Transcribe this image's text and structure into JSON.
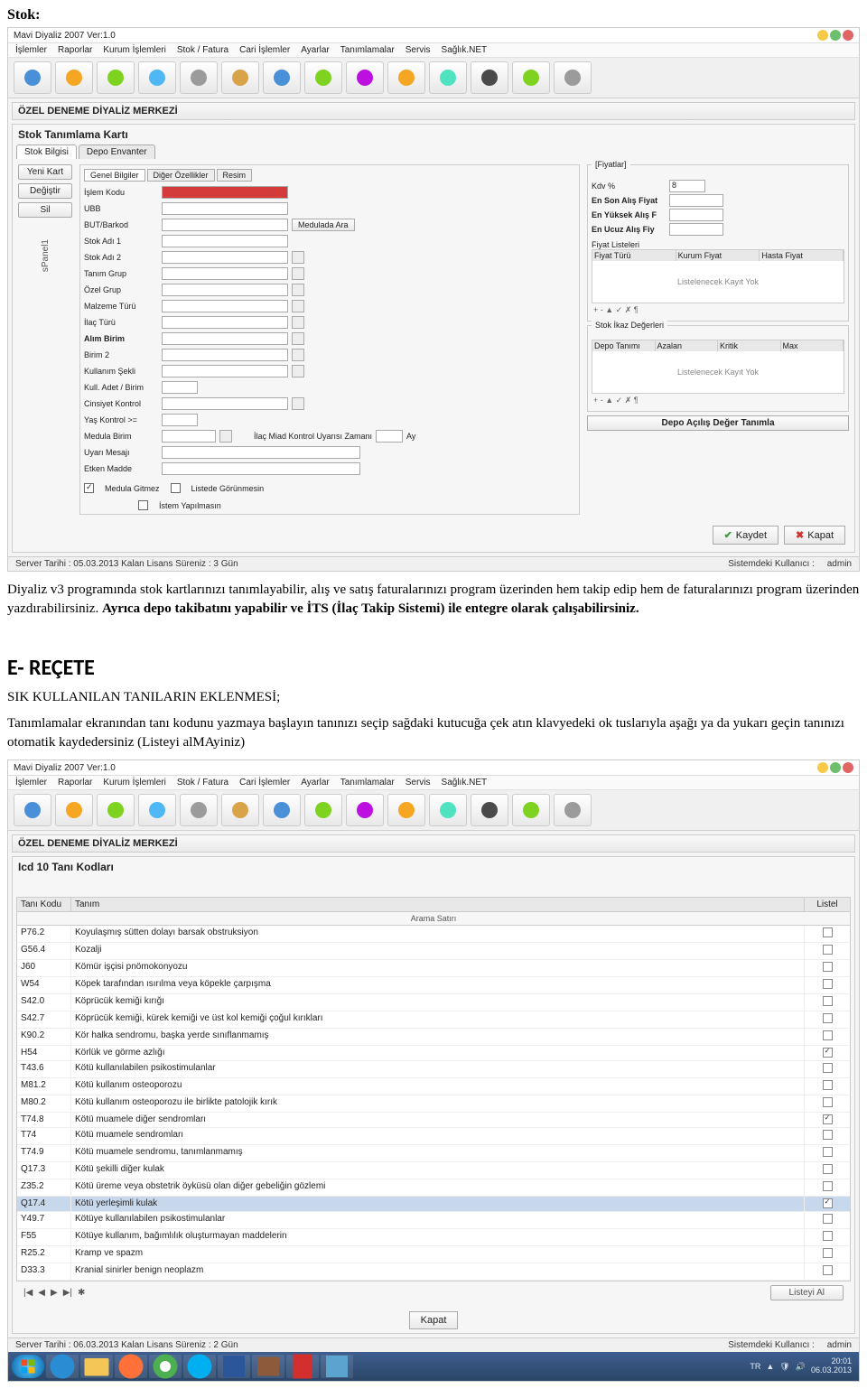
{
  "doc": {
    "heading_stok": "Stok:",
    "para1_plain": "Diyaliz v3 programında stok kartlarınızı tanımlayabilir, alış ve satış faturalarınızı program üzerinden hem takip edip hem de faturalarınızı program üzerinden yazdırabilirsiniz. ",
    "para1_bold": "Ayrıca depo takibatını yapabilir ve İTS (İlaç Takip Sistemi) ile entegre olarak çalışabilirsiniz.",
    "heading_erecete": "E- REÇETE",
    "para2": "SIK KULLANILAN TANILARIN EKLENMESİ;",
    "para3": "Tanımlamalar ekranından tanı kodunu yazmaya başlayın tanınızı seçip sağdaki kutucuğa çek atın klavyedeki ok tuslarıyla aşağı ya da yukarı geçin tanınızı otomatik kaydedersiniz (Listeyi alMAyiniz)"
  },
  "shot1": {
    "title": "Mavi Diyaliz 2007 Ver:1.0",
    "menu": [
      "İşlemler",
      "Raporlar",
      "Kurum İşlemleri",
      "Stok / Fatura",
      "Cari İşlemler",
      "Ayarlar",
      "Tanımlamalar",
      "Servis",
      "Sağlık.NET"
    ],
    "merkez": "ÖZEL DENEME DİYALİZ MERKEZİ",
    "card_title": "Stok Tanımlama Kartı",
    "tabs": [
      "Stok Bilgisi",
      "Depo Envanter"
    ],
    "left_buttons": [
      "Yeni Kart",
      "Değiştir",
      "Sil"
    ],
    "spanel": "sPanel1",
    "subtabs": [
      "Genel Bilgiler",
      "Diğer Özellikler",
      "Resim"
    ],
    "fields": {
      "islem_kodu": "İşlem Kodu",
      "ubb": "UBB",
      "but_barkod": "BUT/Barkod",
      "stok_adi1": "Stok Adı 1",
      "stok_adi2": "Stok Adı 2",
      "tanim_grup": "Tanım Grup",
      "ozel_grup": "Özel Grup",
      "malzeme_turu": "Malzeme Türü",
      "ilac_turu": "İlaç Türü",
      "alim_birim": "Alım Birim",
      "birim2": "Birim 2",
      "kullanim_sekli": "Kullanım Şekli",
      "kull_adet_birim": "Kull. Adet / Birim",
      "cinsiyet_kontrol": "Cinsiyet Kontrol",
      "yas_kontrol": "Yaş Kontrol >=",
      "medula_birim": "Medula Birim",
      "uyari_mesaji": "Uyarı Mesajı",
      "etken_madde": "Etken Madde",
      "medulada_ara": "Medulada Ara",
      "ilac_miad": "İlaç Miad Kontrol Uyarısı Zamanı",
      "ay": "Ay"
    },
    "checks": {
      "medula_gitmez": "Medula Gitmez",
      "listede_gorunmesin": "Listede Görünmesin",
      "istem_yapilmasin": "İstem Yapılmasın"
    },
    "right": {
      "fiyatlar": "[Fiyatlar]",
      "kdv": "Kdv %",
      "kdv_val": "8",
      "en_son_alis": "En Son Alış Fiyat",
      "en_yuksek_alis": "En Yüksek Alış F",
      "en_ucuz_alis": "En Ucuz Alış Fiy",
      "fiyat_listeleri": "Fiyat Listeleri",
      "fiyat_turu": "Fiyat Türü",
      "kurum_fiyat": "Kurum Fiyat",
      "hasta_fiyat": "Hasta Fiyat",
      "kayit_yok": "Listelenecek Kayıt Yok",
      "stok_ikaz": "Stok İkaz Değerleri",
      "depo_tanimi": "Depo Tanımı",
      "azalan": "Azalan",
      "kritik": "Kritik",
      "max": "Max",
      "depo_acilis": "Depo Açılış Değer Tanımla"
    },
    "footer": {
      "kaydet": "Kaydet",
      "kapat": "Kapat"
    },
    "status": {
      "left": "Server Tarihi : 05.03.2013  Kalan Lisans Süreniz : 3 Gün",
      "mid": "Sistemdeki Kullanıcı :",
      "right": "admin"
    }
  },
  "shot2": {
    "title": "Mavi Diyaliz 2007 Ver:1.0",
    "menu": [
      "İşlemler",
      "Raporlar",
      "Kurum İşlemleri",
      "Stok / Fatura",
      "Cari İşlemler",
      "Ayarlar",
      "Tanımlamalar",
      "Servis",
      "Sağlık.NET"
    ],
    "merkez": "ÖZEL DENEME DİYALİZ MERKEZİ",
    "card_title": "Icd 10 Tanı Kodları",
    "cols": {
      "c1": "Tanı Kodu",
      "c2": "Tanım",
      "c3": "Listel"
    },
    "search": "Arama Satırı",
    "rows": [
      {
        "code": "P76.2",
        "name": "Koyulaşmış sütten dolayı barsak obstruksiyon",
        "chk": false
      },
      {
        "code": "G56.4",
        "name": "Kozalji",
        "chk": false
      },
      {
        "code": "J60",
        "name": "Kömür işçisi pnömokonyozu",
        "chk": false
      },
      {
        "code": "W54",
        "name": "Köpek tarafından ısırılma veya köpekle çarpışma",
        "chk": false
      },
      {
        "code": "S42.0",
        "name": "Köprücük kemiği kırığı",
        "chk": false
      },
      {
        "code": "S42.7",
        "name": "Köprücük kemiği, kürek kemiği ve üst kol kemiği çoğul kırıkları",
        "chk": false
      },
      {
        "code": "K90.2",
        "name": "Kör halka sendromu, başka yerde sınıflanmamış",
        "chk": false
      },
      {
        "code": "H54",
        "name": "Körlük ve görme azlığı",
        "chk": true
      },
      {
        "code": "T43.6",
        "name": "Kötü kullanılabilen psikostimulanlar",
        "chk": false
      },
      {
        "code": "M81.2",
        "name": "Kötü kullanım osteoporozu",
        "chk": false
      },
      {
        "code": "M80.2",
        "name": "Kötü kullanım osteoporozu ile birlikte patolojik kırık",
        "chk": false
      },
      {
        "code": "T74.8",
        "name": "Kötü muamele diğer sendromları",
        "chk": true
      },
      {
        "code": "T74",
        "name": "Kötü muamele sendromları",
        "chk": false
      },
      {
        "code": "T74.9",
        "name": "Kötü muamele sendromu, tanımlanmamış",
        "chk": false
      },
      {
        "code": "Q17.3",
        "name": "Kötü şekilli diğer kulak",
        "chk": false
      },
      {
        "code": "Z35.2",
        "name": "Kötü üreme veya obstetrik öyküsü olan diğer gebeliğin gözlemi",
        "chk": false
      },
      {
        "code": "Q17.4",
        "name": "Kötü yerleşimli kulak",
        "chk": true,
        "sel": true
      },
      {
        "code": "Y49.7",
        "name": "Kötüye kullanılabilen psikostimulanlar",
        "chk": false
      },
      {
        "code": "F55",
        "name": "Kötüye kullanım, bağımlılık oluşturmayan maddelerin",
        "chk": false
      },
      {
        "code": "R25.2",
        "name": "Kramp ve spazm",
        "chk": false
      },
      {
        "code": "D33.3",
        "name": "Kranial sinirler benign neoplazm",
        "chk": false
      }
    ],
    "pager": {
      "al": "Listeyi Al"
    },
    "kapat": "Kapat",
    "status": {
      "left": "Server Tarihi : 06.03.2013  Kalan Lisans Süreniz : 2 Gün",
      "mid": "Sistemdeki Kullanıcı :",
      "right": "admin"
    },
    "taskbar": {
      "lang": "TR",
      "time": "20:01",
      "date": "06.03.2013"
    }
  }
}
